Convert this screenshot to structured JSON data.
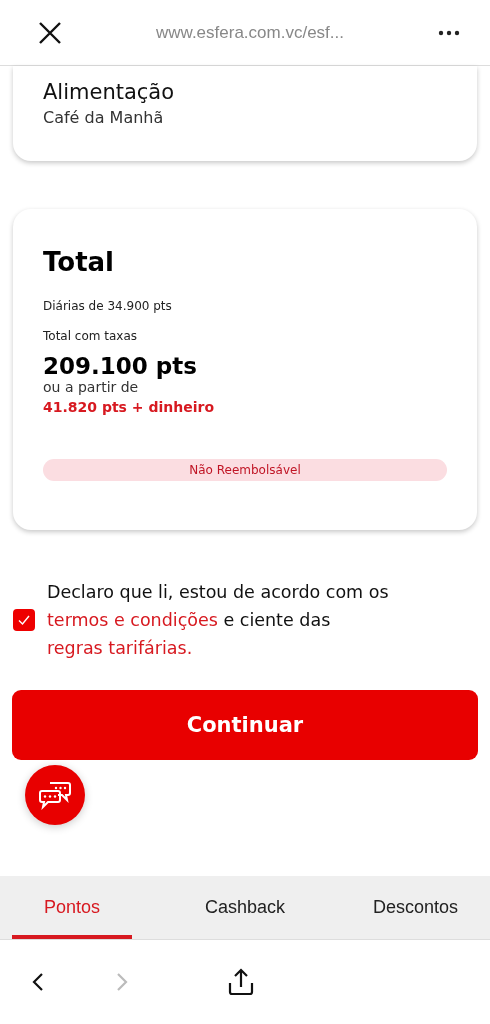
{
  "browser_header": {
    "url": "www.esfera.com.vc/esf..."
  },
  "meal_card": {
    "title": "Alimentação",
    "subtitle": "Café da Manhã"
  },
  "total_card": {
    "title": "Total",
    "daily": "Diárias de 34.900 pts",
    "total_label": "Total com taxas",
    "total_value": "209.100 pts",
    "alt_label": "ou a partir de",
    "alt_value": "41.820 pts + dinheiro",
    "badge": "Não Reembolsável"
  },
  "consent": {
    "checked": true,
    "parts": [
      {
        "kind": "text",
        "text": "Declaro que li, estou de acordo com os "
      },
      {
        "kind": "link",
        "text": "termos e condições"
      },
      {
        "kind": "text",
        "text": " e ciente das "
      },
      {
        "kind": "link",
        "text": "regras tarifárias."
      }
    ]
  },
  "continue_button": "Continuar",
  "tabs": [
    {
      "label": "Pontos",
      "selected": true
    },
    {
      "label": "Cashback",
      "selected": false
    },
    {
      "label": "Descontos",
      "selected": false
    }
  ],
  "browser_nav": {
    "back_disabled": false,
    "forward_disabled": true
  }
}
